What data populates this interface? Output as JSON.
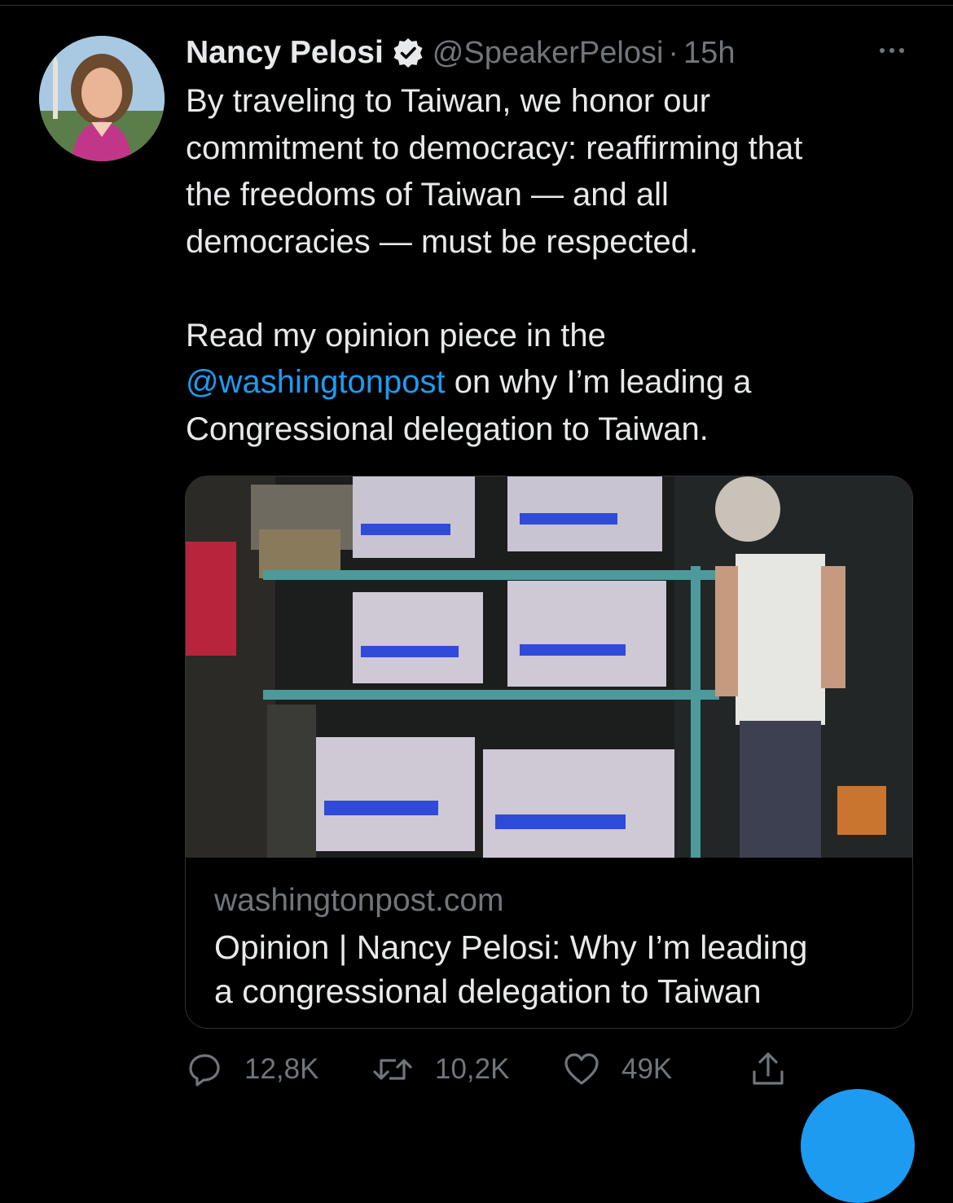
{
  "tweet": {
    "author_name": "Nancy Pelosi",
    "handle": "@SpeakerPelosi",
    "separator": "·",
    "time": "15h",
    "text_lines": [
      "By traveling to Taiwan, we honor our",
      "commitment to democracy: reaffirming that",
      "the freedoms of Taiwan — and all",
      "democracies — must be respected."
    ],
    "text2_line1": "Read my opinion piece in the",
    "text2_mention": "@washingtonpost",
    "text2_line2_rest": " on why I’m leading a",
    "text2_line3": "Congressional delegation to Taiwan."
  },
  "card": {
    "domain": "washingtonpost.com",
    "title_line1": "Opinion | Nancy Pelosi: Why I’m leading",
    "title_line2": "a congressional delegation to Taiwan"
  },
  "actions": {
    "replies": "12,8K",
    "retweets": "10,2K",
    "likes": "49K"
  },
  "icons": [
    "verified-badge-icon",
    "more-icon",
    "reply-icon",
    "retweet-icon",
    "like-icon",
    "share-icon"
  ],
  "colors": {
    "background": "#000000",
    "text": "#e7e9ea",
    "secondary": "#71767b",
    "accent": "#1d9bf0"
  }
}
